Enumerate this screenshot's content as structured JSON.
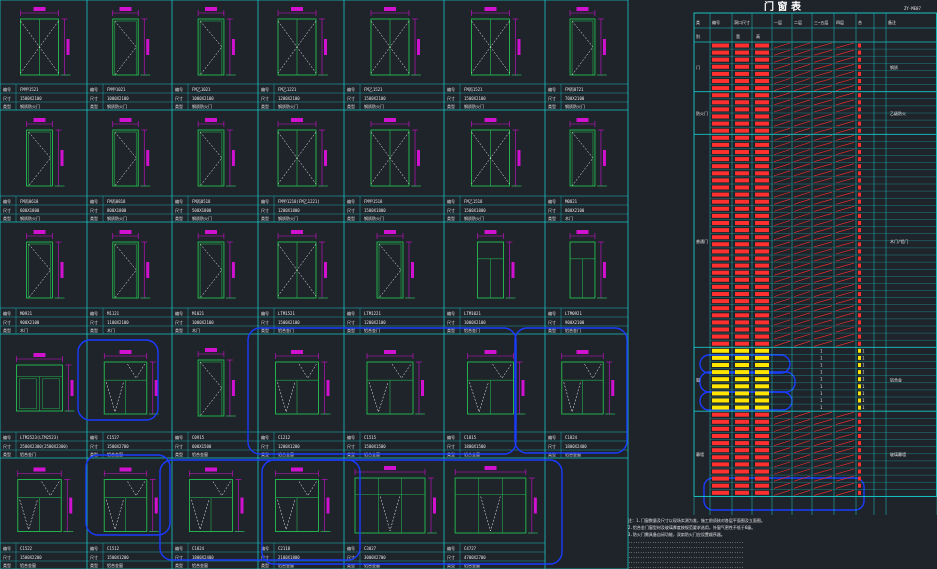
{
  "drawing": {
    "type": "door-window schedule (CAD drawing)",
    "colors": {
      "background": "#1f232a",
      "grid": "#19c6c6",
      "frame": "#22b14c",
      "dimension": "#d012d0",
      "swing": "#ffffff",
      "table_code": "#ff3030",
      "table_slash": "#ff3030",
      "note": "#ffe600",
      "cloud": "#1a3cff"
    },
    "panels": [
      {
        "code": "FM甲1521",
        "size": "1500X2100",
        "mat": "钢质防火门",
        "kind": "door2"
      },
      {
        "code": "FM甲1021",
        "size": "1000X2100",
        "mat": "钢质防火门",
        "kind": "door1"
      },
      {
        "code": "FM乙1021",
        "size": "1000X2100",
        "mat": "钢质防火门",
        "kind": "door1"
      },
      {
        "code": "FM乙1221",
        "size": "1200X2100",
        "mat": "钢质防火门",
        "kind": "door2"
      },
      {
        "code": "FM乙1521",
        "size": "1500X2100",
        "mat": "钢质防火门",
        "kind": "door2"
      },
      {
        "code": "FM丙1521",
        "size": "1500X2100",
        "mat": "钢质防火门",
        "kind": "door2"
      },
      {
        "code": "FM丙0721",
        "size": "700X2100",
        "mat": "钢质防火门",
        "kind": "door1"
      },
      {
        "code": "FM丙0618",
        "size": "600X1800",
        "mat": "钢质防火门",
        "kind": "door1"
      },
      {
        "code": "FM丙0818",
        "size": "800X1800",
        "mat": "钢质防火门",
        "kind": "door1"
      },
      {
        "code": "FM丙0518",
        "size": "500X1800",
        "mat": "钢质防火门",
        "kind": "door1"
      },
      {
        "code": "FM甲1218(FM乙1221)",
        "size": "1200X1800",
        "mat": "钢质防火门",
        "kind": "door2"
      },
      {
        "code": "FM甲1518",
        "size": "1500X1800",
        "mat": "钢质防火门",
        "kind": "door2"
      },
      {
        "code": "FM乙1518",
        "size": "1500X1800",
        "mat": "钢质防火门",
        "kind": "door2"
      },
      {
        "code": "M0821",
        "size": "800X2100",
        "mat": "木门",
        "kind": "door1"
      },
      {
        "code": "M0921",
        "size": "900X2100",
        "mat": "木门",
        "kind": "door1"
      },
      {
        "code": "M1121",
        "size": "1100X2100",
        "mat": "木门",
        "kind": "door1"
      },
      {
        "code": "M1021",
        "size": "1000X2100",
        "mat": "木门",
        "kind": "door1"
      },
      {
        "code": "LTM1521",
        "size": "1500X2100",
        "mat": "铝合金门",
        "kind": "door2"
      },
      {
        "code": "LTM1221",
        "size": "1200X2100",
        "mat": "铝合金门",
        "kind": "door1"
      },
      {
        "code": "LTM1021",
        "size": "1000X2100",
        "mat": "铝合金门",
        "kind": "glass"
      },
      {
        "code": "LTM0921",
        "size": "900X2100",
        "mat": "铝合金门",
        "kind": "glass"
      },
      {
        "code": "LTM2523(LTM2523)",
        "size": "2500X2300(2500X2300)",
        "mat": "铝合金门",
        "kind": "slide"
      },
      {
        "code": "C1527",
        "size": "1500X2700",
        "mat": "铝合金窗",
        "kind": "win"
      },
      {
        "code": "C0915",
        "size": "600X1500",
        "mat": "铝合金窗",
        "kind": "door1"
      },
      {
        "code": "C1212",
        "size": "1200X1200",
        "mat": "铝合金窗",
        "kind": "win"
      },
      {
        "code": "C1515",
        "size": "1500X1500",
        "mat": "铝合金窗",
        "kind": "win"
      },
      {
        "code": "C1815",
        "size": "1800X1500",
        "mat": "铝合金窗",
        "kind": "win"
      },
      {
        "code": "C1824",
        "size": "1800X2400",
        "mat": "铝合金窗",
        "kind": "win"
      },
      {
        "code": "C1522",
        "size": "1500X2200",
        "mat": "铝合金窗",
        "kind": "win"
      },
      {
        "code": "C1512",
        "size": "1500X1200",
        "mat": "铝合金窗",
        "kind": "win"
      },
      {
        "code": "C1824",
        "size": "1800X2400",
        "mat": "铝合金窗",
        "kind": "win"
      },
      {
        "code": "C2118",
        "size": "2100X1800",
        "mat": "铝合金窗",
        "kind": "win"
      },
      {
        "code": "C3027",
        "size": "3000X2700",
        "mat": "铝合金窗",
        "kind": "bigwin"
      },
      {
        "code": "C4727",
        "size": "4700X2700",
        "mat": "铝合金窗",
        "kind": "bigwin"
      }
    ],
    "table": {
      "title": "门 窗 表",
      "corner": "ZY-ME07",
      "headers": [
        "类",
        "编号",
        "洞口尺寸",
        "数量",
        "一层",
        "二层",
        "三~五层",
        "四层",
        "合",
        "备注"
      ],
      "subheaders": [
        "别",
        "",
        "宽",
        "高"
      ],
      "groups": [
        {
          "name": "门",
          "rows": 7,
          "note": "钢质"
        },
        {
          "name": "防火门",
          "rows": 6,
          "note": "乙级防火"
        },
        {
          "name": "普通门",
          "rows": 30,
          "note": "木门/铝门"
        },
        {
          "name": "窗",
          "rows": 9,
          "note": "铝合金"
        },
        {
          "name": "幕墙",
          "rows": 12,
          "note": "玻璃幕墙"
        }
      ]
    },
    "notes": [
      "注：1.门窗数量及尺寸以现场实测为准，施工前须核对各层平面图及立面图。",
      "2.铝合金门窗型材及玻璃厚度按规范要求选用，外窗气密性不低于6级。",
      "3.防火门需具备自闭功能，双扇防火门应设置顺序器。"
    ]
  }
}
